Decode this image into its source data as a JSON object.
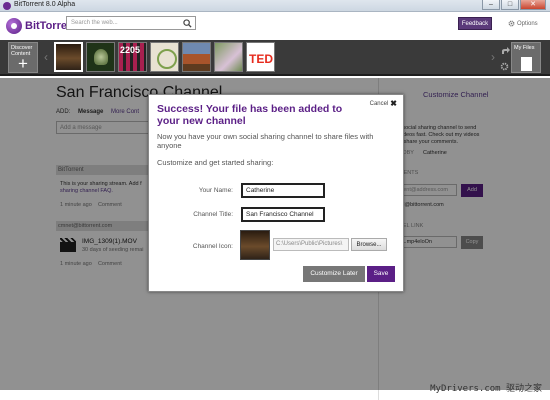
{
  "window": {
    "title": "BitTorrent 8.0 Alpha",
    "min": "–",
    "max": "□",
    "close": "✕"
  },
  "header": {
    "logo_text": "BitTorrent",
    "search_placeholder": "Search the web...",
    "feedback_label": "Feedback",
    "options_label": "Options"
  },
  "toolbar": {
    "discover_label": "Discover Content",
    "myfiles_label": "My Files",
    "thumbs": [
      {
        "name": "channel-thumb-1",
        "text": ""
      },
      {
        "name": "channel-thumb-2",
        "text": ""
      },
      {
        "name": "channel-thumb-3",
        "text": "2205"
      },
      {
        "name": "channel-thumb-4",
        "text": ""
      },
      {
        "name": "channel-thumb-5",
        "text": ""
      },
      {
        "name": "channel-thumb-6",
        "text": ""
      },
      {
        "name": "channel-thumb-7",
        "text": "TED"
      }
    ]
  },
  "main": {
    "channel_title": "San Francisco Channel",
    "add_label": "ADD:",
    "add_message": "Message",
    "add_more": "More Cont",
    "message_placeholder": "Add a message",
    "feed_source": "BitTorrent",
    "feed_text": "This is your sharing stream. Add f",
    "feed_link": "sharing channel FAQ.",
    "feed_time": "1 minute ago",
    "feed_comment": "Comment",
    "file_source": "cmnet@bittorrent.com",
    "file_name": "IMG_1309(1).MOV",
    "file_sub": "30 days of seeding remai",
    "file_time": "1 minute ago",
    "file_comment": "Comment"
  },
  "sidebar": {
    "customize": "Customize Channel",
    "desc": "r social sharing channel to send\nvideos fast. Check out my videos\nd share your comments.",
    "created_label": "EDBY",
    "created_val": "Catherine",
    "members_label": "MENTS",
    "email_placeholder": "ient@address.com",
    "add_btn": "Add",
    "member": "lel@bittorrent.com",
    "link_label": "NEL LINK",
    "link_val": "L.mp4eloOn",
    "copy_btn": "Copy"
  },
  "dialog": {
    "title": "Success! Your file has been added to your new channel",
    "cancel_label": "Cancel",
    "subtitle": "Now you have your own social sharing channel to share files with anyone",
    "customize_heading": "Customize and get started sharing:",
    "name_label": "Your Name:",
    "name_value": "Catherine",
    "channel_title_label": "Channel Title:",
    "channel_title_value": "San Francisco Channel",
    "channel_icon_label": "Channel Icon:",
    "icon_path": "C:\\Users\\Public\\Pictures\\",
    "browse_label": "Browse...",
    "customize_later_label": "Customize Later",
    "save_label": "Save"
  },
  "watermark": "MyDrivers.com 驱动之家",
  "colors": {
    "brand": "#5b1f86",
    "accent": "#5b3a8f"
  }
}
